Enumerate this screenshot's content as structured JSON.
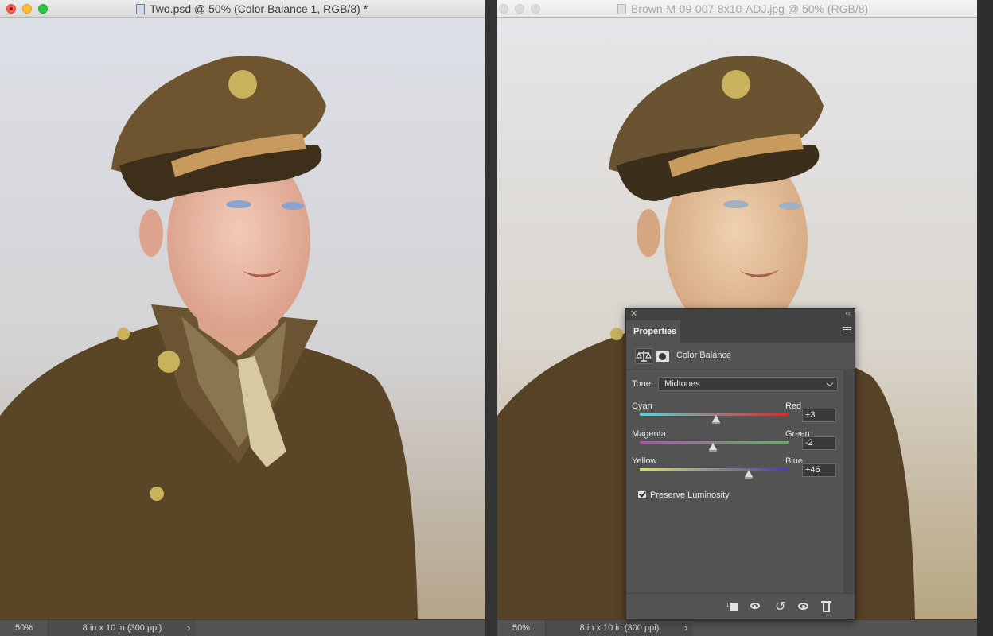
{
  "windows": {
    "left": {
      "title": "Two.psd @ 50% (Color Balance 1, RGB/8) *",
      "zoom": "50%",
      "doc_size": "8 in x 10 in (300 ppi)"
    },
    "right": {
      "title": "Brown-M-09-007-8x10-ADJ.jpg @ 50% (RGB/8)",
      "zoom": "50%",
      "doc_size": "8 in x 10 in (300 ppi)"
    }
  },
  "properties_panel": {
    "tab_label": "Properties",
    "adjustment_title": "Color Balance",
    "tone_label": "Tone:",
    "tone_value": "Midtones",
    "sliders": [
      {
        "left": "Cyan",
        "right": "Red",
        "value": "+3",
        "amount": 3,
        "colors": [
          "#5fd3d6",
          "#d22c2c"
        ]
      },
      {
        "left": "Magenta",
        "right": "Green",
        "value": "-2",
        "amount": -2,
        "colors": [
          "#d03ad3",
          "#3fcb3f"
        ]
      },
      {
        "left": "Yellow",
        "right": "Blue",
        "value": "+46",
        "amount": 46,
        "colors": [
          "#e8e23a",
          "#3a3ad8"
        ]
      }
    ],
    "preserve_luminosity": {
      "label": "Preserve Luminosity",
      "checked": true
    }
  }
}
